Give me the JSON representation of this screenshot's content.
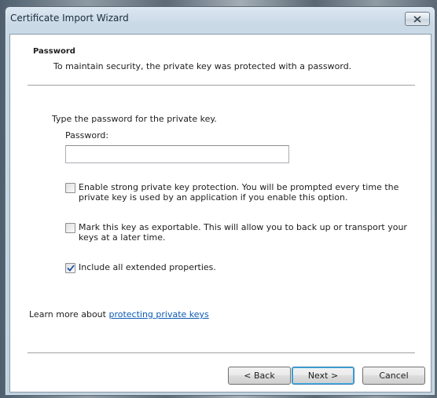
{
  "window": {
    "title": "Certificate Import Wizard",
    "close_icon": "close-icon"
  },
  "header": {
    "title": "Password",
    "description": "To maintain security, the private key was protected with a password."
  },
  "form": {
    "prompt": "Type the password for the private key.",
    "password_label": "Password:",
    "password_value": "",
    "password_placeholder": ""
  },
  "options": [
    {
      "label": "Enable strong private key protection. You will be prompted every time the private key is used by an application if you enable this option.",
      "checked": false
    },
    {
      "label": "Mark this key as exportable. This will allow you to back up or transport your keys at a later time.",
      "checked": false
    },
    {
      "label": "Include all extended properties.",
      "checked": true
    }
  ],
  "learn_more": {
    "prefix": "Learn more about ",
    "link": "protecting private keys"
  },
  "buttons": {
    "back": "< Back",
    "next": "Next >",
    "cancel": "Cancel"
  },
  "colors": {
    "link": "#0d5ab5",
    "check_mark": "#1b50a8"
  }
}
